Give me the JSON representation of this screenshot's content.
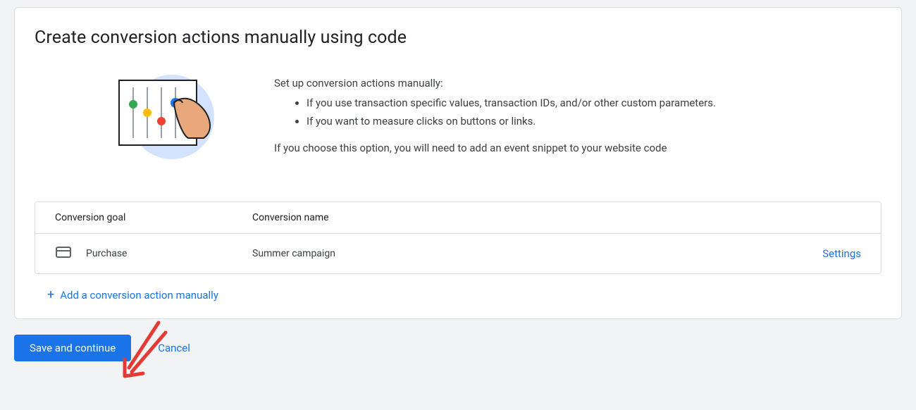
{
  "title": "Create conversion actions manually using code",
  "intro": {
    "lead": "Set up conversion actions manually:",
    "bullets": [
      "If you use transaction specific values, transaction IDs, and/or other custom parameters.",
      "If you want to measure clicks on buttons or links."
    ],
    "note": "If you choose this option, you will need to add an event snippet to your website code"
  },
  "table": {
    "headers": {
      "goal": "Conversion goal",
      "name": "Conversion name"
    },
    "rows": [
      {
        "goal": "Purchase",
        "name": "Summer campaign",
        "action": "Settings"
      }
    ]
  },
  "add_link": "Add a conversion action manually",
  "footer": {
    "save": "Save and continue",
    "cancel": "Cancel"
  }
}
